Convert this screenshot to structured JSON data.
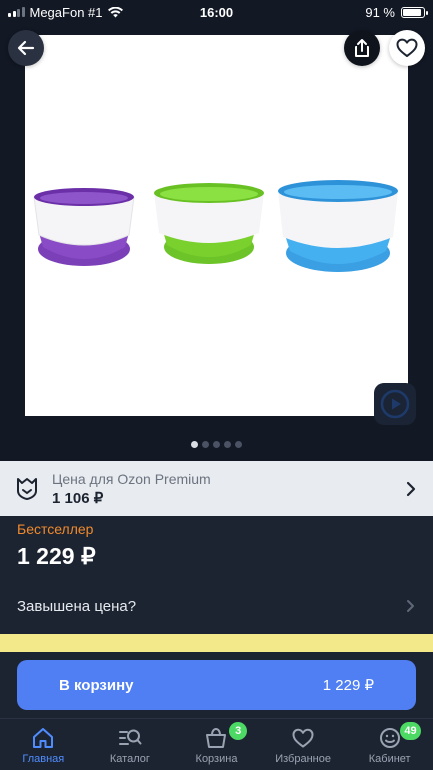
{
  "status_bar": {
    "carrier": "MegaFon #1",
    "time": "16:00",
    "battery": "91 %",
    "battery_level": 0.91
  },
  "gallery": {
    "slide_count": 5,
    "active_slide": 1,
    "product_colors": [
      "#7b3fb8",
      "#7ad12e",
      "#3ea6e8"
    ]
  },
  "premium": {
    "label": "Цена для Ozon Premium",
    "price": "1 106 ₽"
  },
  "product": {
    "badge": "Бестселлер",
    "price": "1 229 ₽",
    "overpriced_question": "Завышена цена?"
  },
  "cart_button": {
    "label": "В корзину",
    "price": "1 229 ₽"
  },
  "tabbar": {
    "items": [
      {
        "label": "Главная",
        "icon": "home-icon",
        "active": true
      },
      {
        "label": "Каталог",
        "icon": "catalog-search-icon"
      },
      {
        "label": "Корзина",
        "icon": "cart-icon",
        "badge": "3"
      },
      {
        "label": "Избранное",
        "icon": "heart-icon"
      },
      {
        "label": "Кабинет",
        "icon": "profile-smile-icon",
        "badge": "49"
      }
    ]
  },
  "colors": {
    "accent_blue": "#4f7ff2",
    "bestseller_orange": "#f08a2c",
    "badge_green": "#4cd964",
    "background": "#1d2431"
  }
}
